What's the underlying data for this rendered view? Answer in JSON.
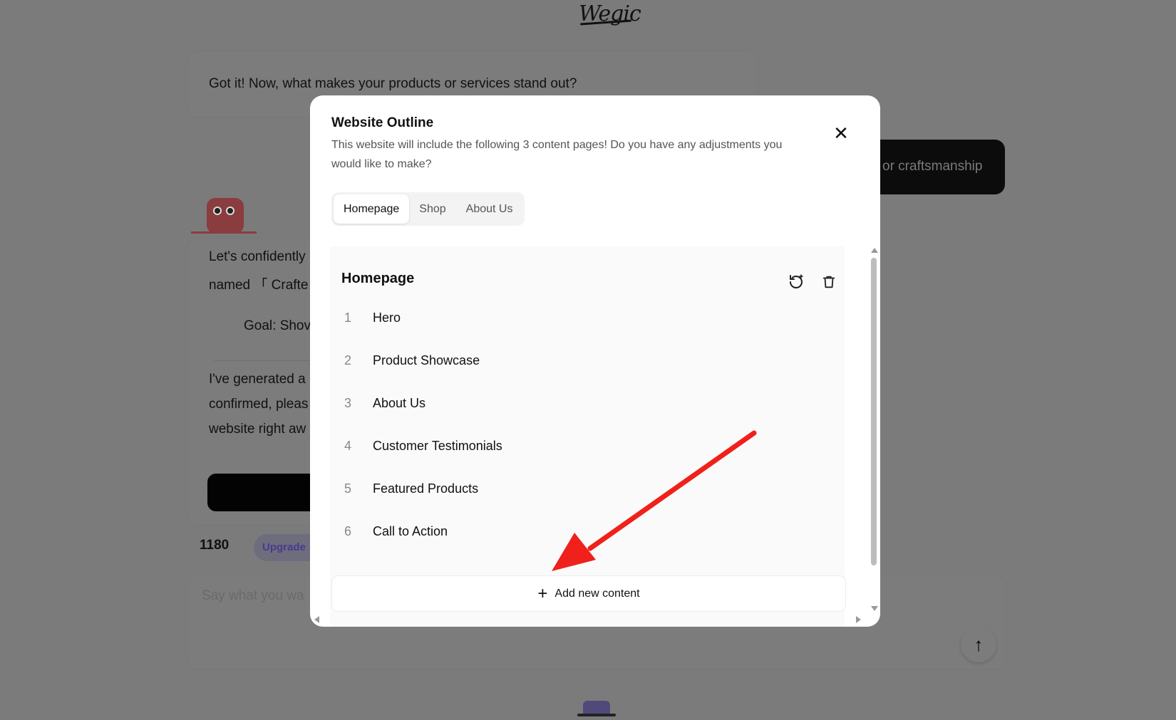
{
  "logo": {
    "text": "Wegic"
  },
  "background": {
    "question": "Got it! Now, what makes your products or services stand out?",
    "user_answer": "or craftsmanship",
    "reply_lines": [
      "Let's confidently",
      "named 「 Crafte"
    ],
    "goal": "Goal: Shov",
    "generated_lines": [
      "I've generated a",
      "confirmed, pleas",
      "website right aw"
    ],
    "credits": "1180",
    "upgrade_label": "Upgrade",
    "input_placeholder": "Say what you wa"
  },
  "modal": {
    "title": "Website Outline",
    "description": "This website will include the following 3 content pages! Do you have any adjustments you would like to make?",
    "tabs": [
      {
        "label": "Homepage",
        "active": true
      },
      {
        "label": "Shop",
        "active": false
      },
      {
        "label": "About Us",
        "active": false
      }
    ],
    "section": {
      "title": "Homepage",
      "items": [
        {
          "num": "1",
          "label": "Hero"
        },
        {
          "num": "2",
          "label": "Product Showcase"
        },
        {
          "num": "3",
          "label": "About Us"
        },
        {
          "num": "4",
          "label": "Customer Testimonials"
        },
        {
          "num": "5",
          "label": "Featured Products"
        },
        {
          "num": "6",
          "label": "Call to Action"
        }
      ]
    },
    "add_label": "Add new content"
  },
  "annotation": {
    "arrow_color": "#f0201a"
  }
}
